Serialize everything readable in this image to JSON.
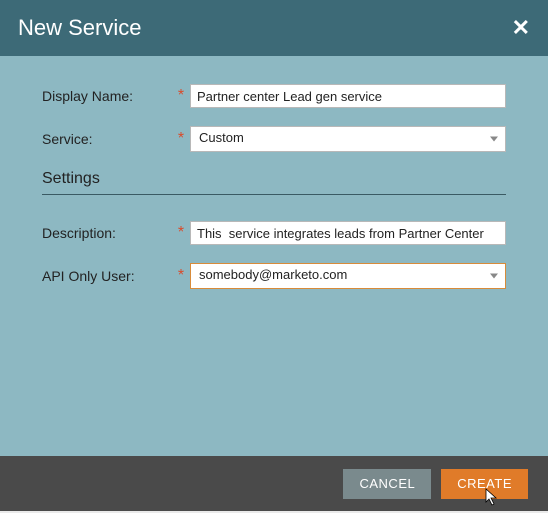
{
  "dialog": {
    "title": "New Service"
  },
  "form": {
    "displayName": {
      "label": "Display Name:",
      "value": "Partner center Lead gen service"
    },
    "service": {
      "label": "Service:",
      "value": "Custom"
    },
    "settingsHeading": "Settings",
    "description": {
      "label": "Description:",
      "value": "This  service integrates leads from Partner Center"
    },
    "apiOnlyUser": {
      "label": "API Only User:",
      "value": "somebody@marketo.com"
    }
  },
  "buttons": {
    "cancel": "CANCEL",
    "create": "CREATE"
  }
}
